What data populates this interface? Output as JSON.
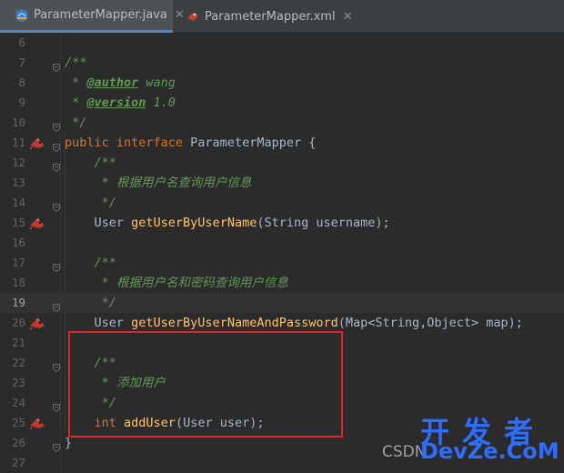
{
  "tabs": [
    {
      "label": "ParameterMapper.java",
      "close": "✕"
    },
    {
      "label": "ParameterMapper.xml",
      "close": "✕"
    }
  ],
  "lines": [
    {
      "n": "6",
      "tokens": []
    },
    {
      "n": "7",
      "tokens": [
        {
          "c": "cm",
          "t": "/**"
        }
      ]
    },
    {
      "n": "8",
      "tokens": [
        {
          "c": "cm",
          "t": " * "
        },
        {
          "c": "tag",
          "t": "@author"
        },
        {
          "c": "cm",
          "t": " wang"
        }
      ]
    },
    {
      "n": "9",
      "tokens": [
        {
          "c": "cm",
          "t": " * "
        },
        {
          "c": "tag",
          "t": "@version"
        },
        {
          "c": "cm",
          "t": " 1.0"
        }
      ]
    },
    {
      "n": "10",
      "tokens": [
        {
          "c": "cm",
          "t": " */"
        }
      ]
    },
    {
      "n": "11",
      "tokens": [
        {
          "c": "kw",
          "t": "public interface "
        },
        {
          "c": "",
          "t": "ParameterMapper {"
        }
      ]
    },
    {
      "n": "12",
      "tokens": [
        {
          "c": "cm",
          "t": "    /**"
        }
      ]
    },
    {
      "n": "13",
      "tokens": [
        {
          "c": "cm",
          "t": "     * 根据用户名查询用户信息"
        }
      ]
    },
    {
      "n": "14",
      "tokens": [
        {
          "c": "cm",
          "t": "     */"
        }
      ]
    },
    {
      "n": "15",
      "tokens": [
        {
          "c": "",
          "t": "    User "
        },
        {
          "c": "fn",
          "t": "getUserByUserName"
        },
        {
          "c": "",
          "t": "(String username);"
        }
      ]
    },
    {
      "n": "16",
      "tokens": []
    },
    {
      "n": "17",
      "tokens": [
        {
          "c": "cm",
          "t": "    /**"
        }
      ]
    },
    {
      "n": "18",
      "tokens": [
        {
          "c": "cm",
          "t": "     * 根据用户名和密码查询用户信息"
        }
      ]
    },
    {
      "n": "19",
      "tokens": [
        {
          "c": "cm",
          "t": "     */"
        }
      ]
    },
    {
      "n": "20",
      "tokens": [
        {
          "c": "",
          "t": "    User "
        },
        {
          "c": "fn",
          "t": "getUserByUserNameAndPassword"
        },
        {
          "c": "",
          "t": "(Map<String,Object> map);"
        }
      ]
    },
    {
      "n": "21",
      "tokens": []
    },
    {
      "n": "22",
      "tokens": [
        {
          "c": "cm",
          "t": "    /**"
        }
      ]
    },
    {
      "n": "23",
      "tokens": [
        {
          "c": "cm",
          "t": "     * 添加用户"
        }
      ]
    },
    {
      "n": "24",
      "tokens": [
        {
          "c": "cm",
          "t": "     */"
        }
      ]
    },
    {
      "n": "25",
      "tokens": [
        {
          "c": "kw",
          "t": "    int "
        },
        {
          "c": "fn",
          "t": "addUser"
        },
        {
          "c": "",
          "t": "(User user);"
        }
      ]
    },
    {
      "n": "26",
      "tokens": [
        {
          "c": "",
          "t": "}"
        }
      ]
    },
    {
      "n": "27",
      "tokens": []
    }
  ],
  "current_line": "19",
  "gutter_icon_lines": [
    "11",
    "15",
    "20",
    "25"
  ],
  "fold_lines": [
    "7",
    "10",
    "11",
    "12",
    "14",
    "17",
    "19",
    "22",
    "24",
    "26"
  ],
  "watermark": {
    "top": "开发者",
    "left": "CSDN",
    "right": "DevZe.CoM"
  },
  "colors": {
    "background": "#2b2b2b",
    "keyword": "#cc7832",
    "comment": "#629755",
    "method": "#ffc66d",
    "highlight_box": "#d9262a"
  },
  "icons": {
    "java_tab": "java-class-icon",
    "xml_tab": "mybatis-mapper-icon",
    "gutter": "mybatis-bird-icon"
  }
}
